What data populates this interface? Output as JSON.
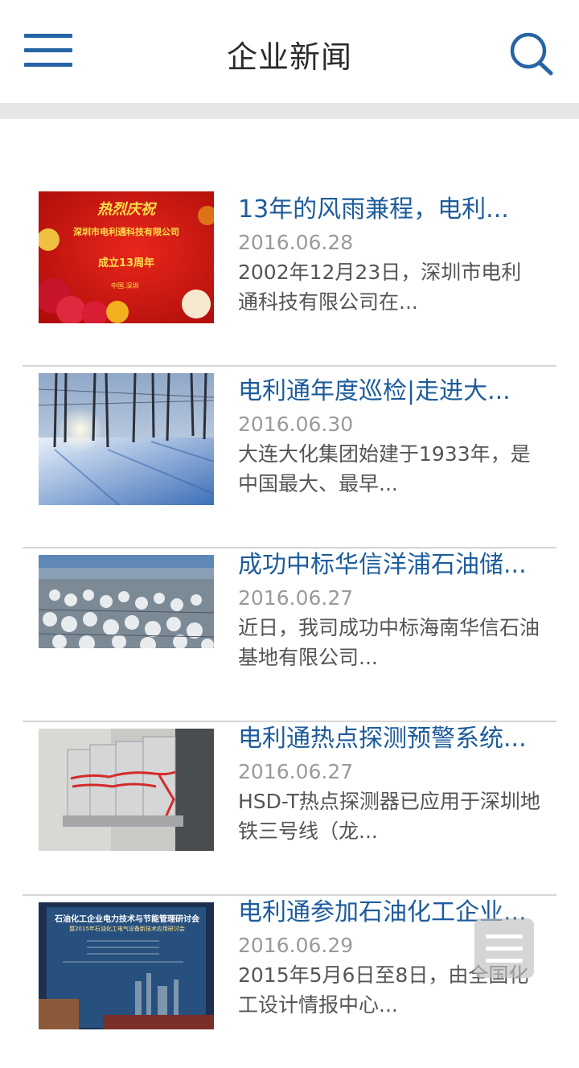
{
  "header": {
    "title": "企业新闻",
    "menu_icon": "hamburger-menu-icon",
    "search_icon": "search-icon",
    "accent_color": "#2664a6"
  },
  "news": [
    {
      "title": "13年的风雨兼程，电利...",
      "date": "2016.06.28",
      "summary": "2002年12月23日，深圳市电利通科技有限公司在...",
      "thumb": {
        "line1": "热烈庆祝",
        "line2": "深圳市电利通科技有限公司",
        "line3": "成立13周年",
        "line4": "中国.深圳"
      }
    },
    {
      "title": "电利通年度巡检|走进大...",
      "date": "2016.06.30",
      "summary": "大连大化集团始建于1933年，是中国最大、最早..."
    },
    {
      "title": "成功中标华信洋浦石油储...",
      "date": "2016.06.27",
      "summary": "近日，我司成功中标海南华信石油基地有限公司..."
    },
    {
      "title": "电利通热点探测预警系统...",
      "date": "2016.06.27",
      "summary": "HSD-T热点探测器已应用于深圳地铁三号线（龙..."
    },
    {
      "title": "电利通参加石油化工企业...",
      "date": "2016.06.29",
      "summary": "2015年5月6日至8日，由全国化工设计情报中心...",
      "thumb": {
        "line1": "石油化工企业电力技术与节能管理研讨会",
        "line2": "暨2015年石油化工电气设备新技术应用研讨会"
      }
    }
  ],
  "floating_menu_icon": "list-menu-icon"
}
